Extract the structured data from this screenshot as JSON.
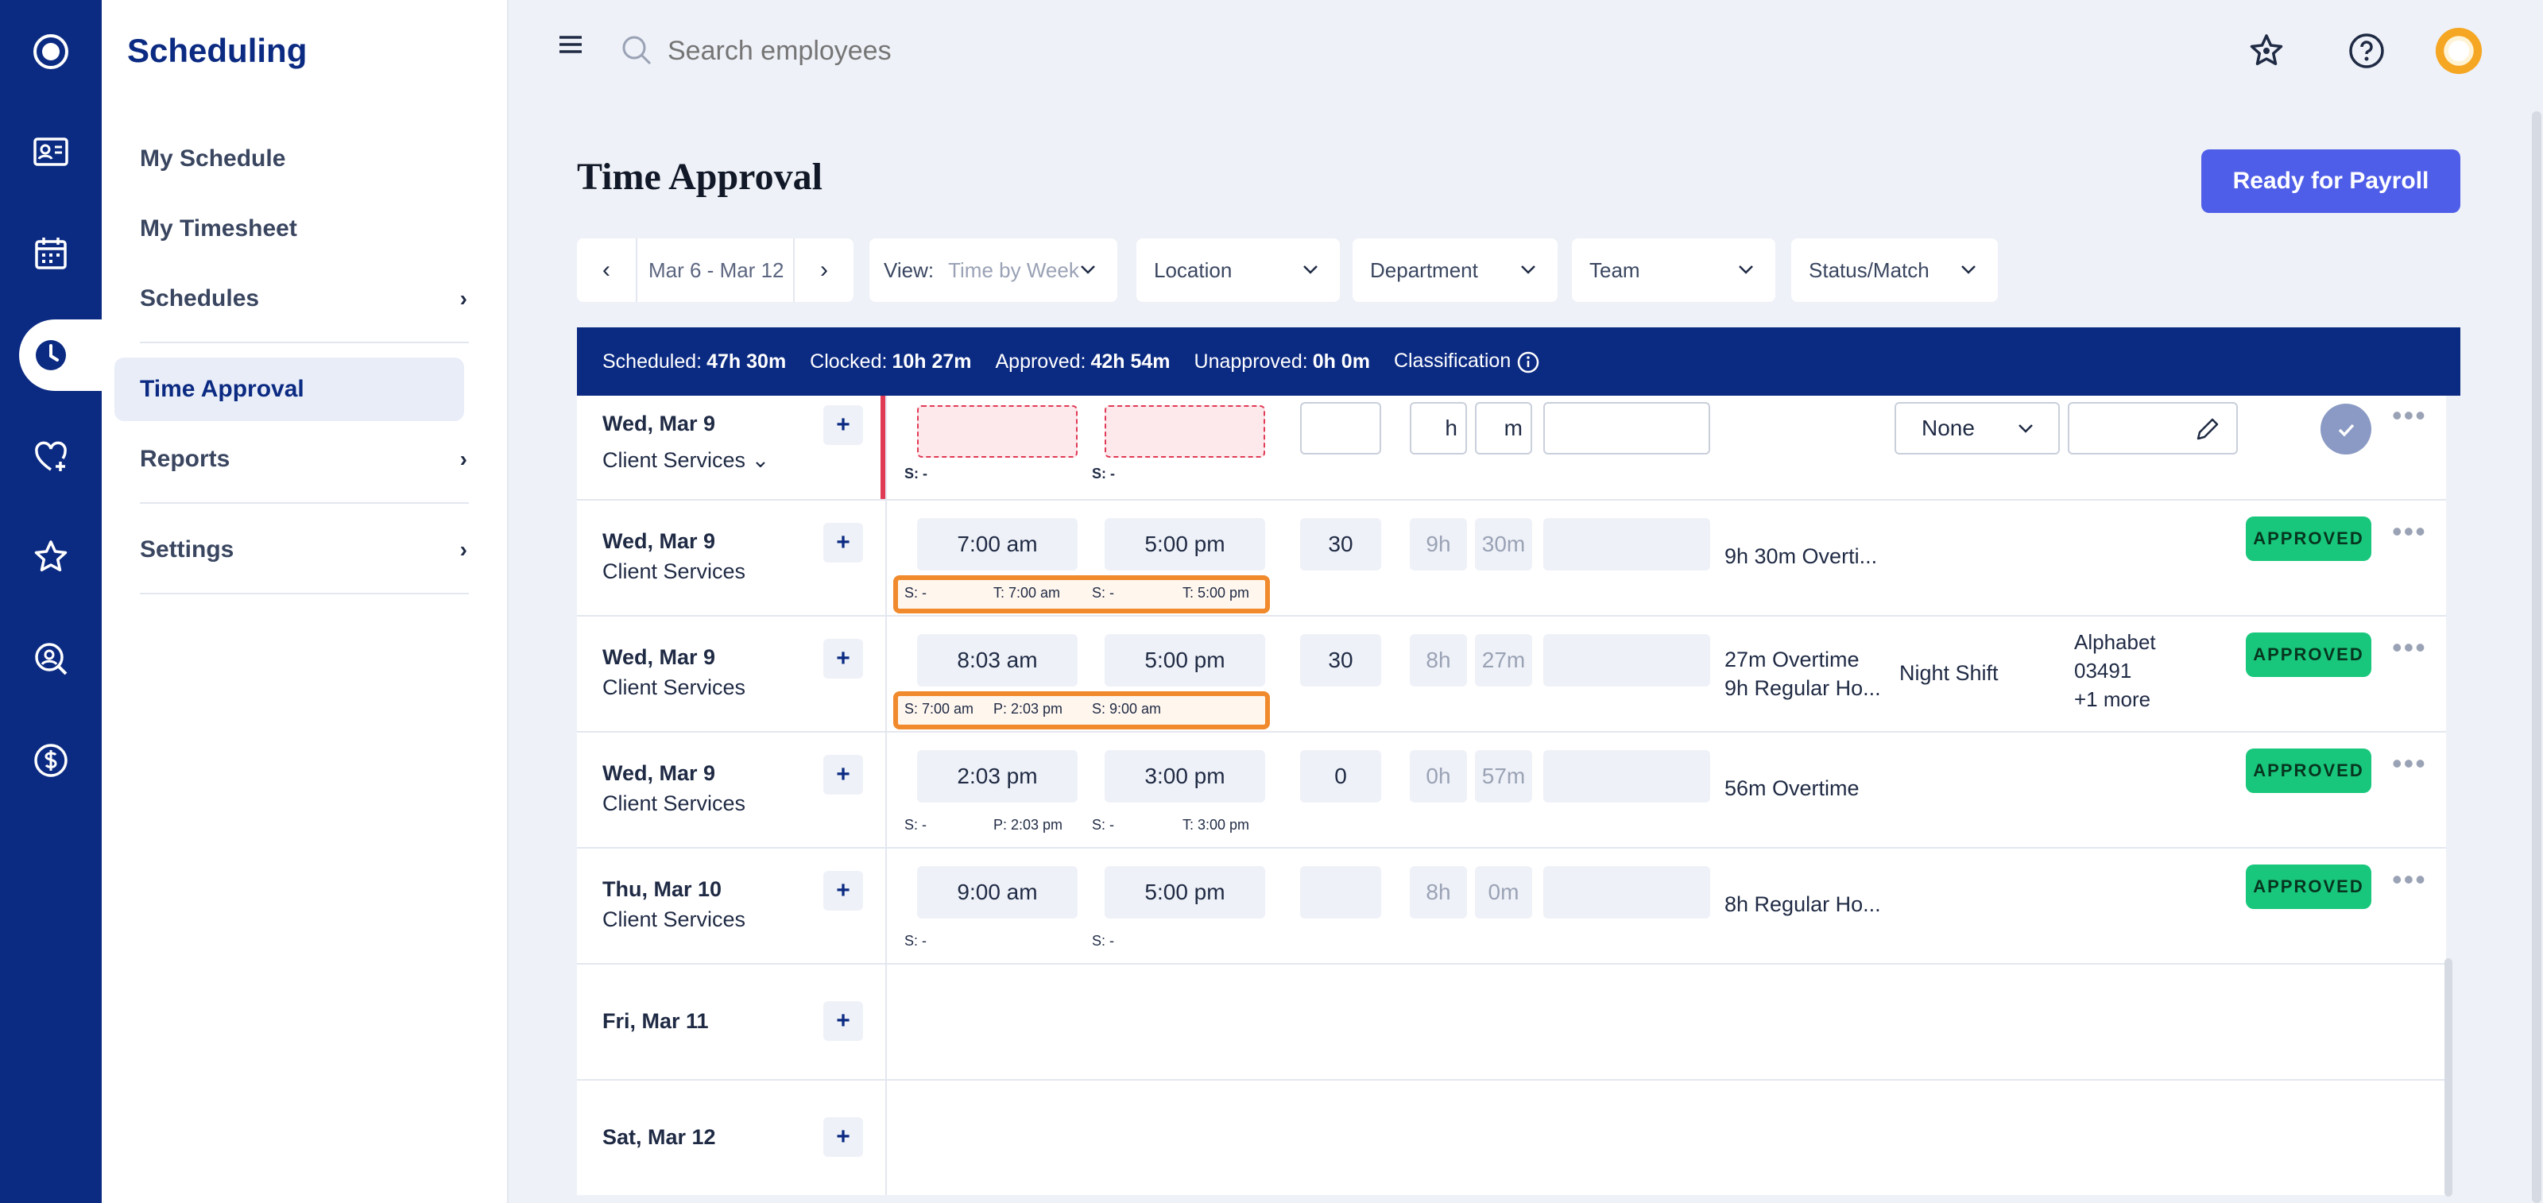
{
  "rail": {
    "items": [
      "logo-icon",
      "id-card-icon",
      "calendar-icon",
      "clock-icon",
      "heart-plus-icon",
      "star-icon",
      "search-person-icon",
      "dollar-icon"
    ],
    "active": "clock-icon"
  },
  "sidebar": {
    "title": "Scheduling",
    "items": [
      {
        "label": "My Schedule"
      },
      {
        "label": "My Timesheet"
      },
      {
        "label": "Schedules"
      },
      {
        "label": "Time Approval"
      },
      {
        "label": "Reports"
      },
      {
        "label": "Settings"
      }
    ]
  },
  "topbar": {
    "search_placeholder": "Search employees"
  },
  "page": {
    "title": "Time Approval",
    "payroll_button": "Ready for Payroll"
  },
  "filters": {
    "date_range": "Mar 6 - Mar 12",
    "view_label": "View:",
    "view_value": "Time by Week",
    "location": "Location",
    "department": "Department",
    "team": "Team",
    "status": "Status/Match"
  },
  "summary": {
    "scheduled_label": "Scheduled:",
    "scheduled_value": "47h 30m",
    "clocked_label": "Clocked:",
    "clocked_value": "10h 27m",
    "approved_label": "Approved:",
    "approved_value": "42h 54m",
    "unapproved_label": "Unapproved:",
    "unapproved_value": "0h 0m",
    "classification_label": "Classification"
  },
  "rows": [
    {
      "date": "Wed, Mar 9",
      "dept": "Client Services",
      "meta1": "S: -",
      "meta2": "S: -",
      "h_label": "h",
      "m_label": "m",
      "select_value": "None"
    },
    {
      "date": "Wed, Mar 9",
      "dept": "Client Services",
      "start": "7:00 am",
      "end": "5:00 pm",
      "break": "30",
      "hours": "9h",
      "mins": "30m",
      "classification": "9h 30m Overti...",
      "meta_s1": "S: -",
      "meta_t1": "T: 7:00 am",
      "meta_s2": "S: -",
      "meta_t2": "T: 5:00 pm",
      "status": "APPROVED"
    },
    {
      "date": "Wed, Mar 9",
      "dept": "Client Services",
      "start": "8:03 am",
      "end": "5:00 pm",
      "break": "30",
      "hours": "8h",
      "mins": "27m",
      "classification1": "27m Overtime",
      "classification2": "9h Regular Ho...",
      "shift": "Night Shift",
      "alpha1": "Alphabet",
      "alpha2": "03491",
      "alpha3": "+1 more",
      "meta_s1": "S: 7:00 am",
      "meta_p1": "P: 2:03 pm",
      "meta_s2": "S: 9:00 am",
      "status": "APPROVED"
    },
    {
      "date": "Wed, Mar 9",
      "dept": "Client Services",
      "start": "2:03 pm",
      "end": "3:00 pm",
      "break": "0",
      "hours": "0h",
      "mins": "57m",
      "classification": "56m Overtime",
      "meta_s1": "S: -",
      "meta_p1": "P: 2:03 pm",
      "meta_s2": "S: -",
      "meta_t2": "T: 3:00 pm",
      "status": "APPROVED"
    },
    {
      "date": "Thu, Mar 10",
      "dept": "Client Services",
      "start": "9:00 am",
      "end": "5:00 pm",
      "hours": "8h",
      "mins": "0m",
      "classification": "8h Regular Ho...",
      "meta_s1": "S: -",
      "meta_s2": "S: -",
      "status": "APPROVED"
    },
    {
      "date": "Fri, Mar 11"
    },
    {
      "date": "Sat, Mar 12"
    }
  ],
  "colors": {
    "primary": "#0b2a82",
    "accent": "#4f5ee8",
    "approved": "#18c77c",
    "highlight": "#f08a2c",
    "error": "#e03a55"
  }
}
